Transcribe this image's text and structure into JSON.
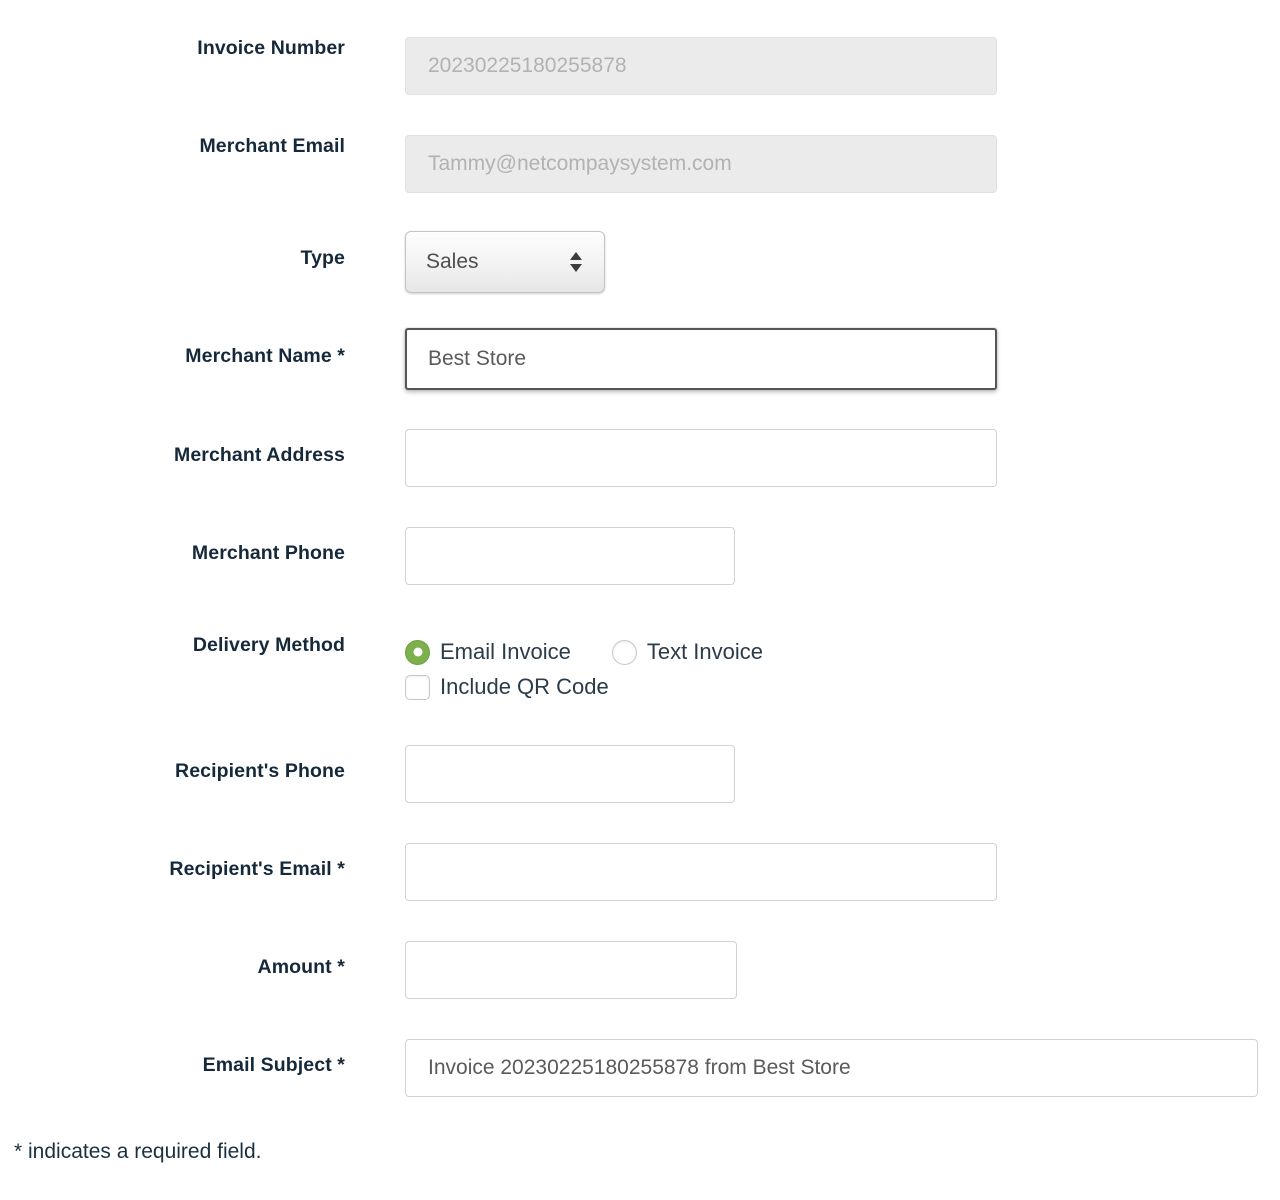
{
  "form": {
    "fields": [
      {
        "label": "Invoice Number",
        "name": "invoice-number",
        "value": "20230225180255878",
        "state": "disabled"
      },
      {
        "label": "Merchant Email",
        "name": "merchant-email",
        "value": "Tammy@netcompaysystem.com",
        "state": "disabled"
      },
      {
        "label": "Type",
        "name": "type",
        "value": "Sales",
        "state": "select",
        "options": [
          "Sales"
        ]
      },
      {
        "label": "Merchant Name *",
        "name": "merchant-name",
        "value": "Best Store",
        "state": "focused"
      },
      {
        "label": "Merchant Address",
        "name": "merchant-address",
        "value": "",
        "state": "empty"
      },
      {
        "label": "Merchant Phone",
        "name": "merchant-phone",
        "value": "",
        "state": "empty"
      },
      {
        "label": "Delivery Method",
        "name": "delivery-method",
        "value": "",
        "state": "choices"
      },
      {
        "label": "Recipient's Phone",
        "name": "recipients-phone",
        "value": "",
        "state": "empty"
      },
      {
        "label": "Recipient's Email *",
        "name": "recipients-email",
        "value": "",
        "state": "empty"
      },
      {
        "label": "Amount *",
        "name": "amount",
        "value": "",
        "state": "empty"
      },
      {
        "label": "Email Subject *",
        "name": "email-subject",
        "value": "Invoice 20230225180255878 from Best Store",
        "state": "filled"
      }
    ],
    "delivery_method": {
      "radios": [
        {
          "label": "Email Invoice",
          "selected": true
        },
        {
          "label": "Text Invoice",
          "selected": false
        }
      ],
      "checkbox": {
        "label": "Include QR Code",
        "checked": false
      }
    },
    "footnote": "* indicates a required field.",
    "colors": {
      "label": "#16293a",
      "value_text": "#5a5a5a",
      "placeholder_text": "#b2b2b2",
      "radio_selected": "#7cb04c",
      "field_border": "#d2d2d2",
      "disabled_bg": "#ebebeb",
      "focus_border": "#565656"
    }
  }
}
